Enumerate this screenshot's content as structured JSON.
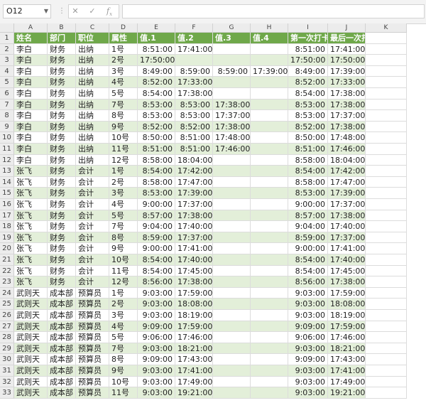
{
  "formula_bar": {
    "name_box": "O12",
    "cancel_icon": "✕",
    "confirm_icon": "✓",
    "fx_label": "f",
    "formula": ""
  },
  "columns": [
    "A",
    "B",
    "C",
    "D",
    "E",
    "F",
    "G",
    "H",
    "I",
    "J",
    "K"
  ],
  "header_row": [
    "姓名",
    "部门",
    "职位",
    "属性",
    "值.1",
    "值.2",
    "值.3",
    "值.4",
    "第一次打卡",
    "最后一次打卡",
    ""
  ],
  "rows": [
    [
      "李白",
      "财务",
      "出纳",
      "1号",
      "8:51:00",
      "17:41:00",
      "",
      "",
      "8:51:00",
      "17:41:00",
      ""
    ],
    [
      "李白",
      "财务",
      "出纳",
      "2号",
      "17:50:00",
      "",
      "",
      "",
      "17:50:00",
      "17:50:00",
      ""
    ],
    [
      "李白",
      "财务",
      "出纳",
      "3号",
      "8:49:00",
      "8:59:00",
      "8:59:00",
      "17:39:00",
      "8:49:00",
      "17:39:00",
      ""
    ],
    [
      "李白",
      "财务",
      "出纳",
      "4号",
      "8:52:00",
      "17:33:00",
      "",
      "",
      "8:52:00",
      "17:33:00",
      ""
    ],
    [
      "李白",
      "财务",
      "出纳",
      "5号",
      "8:54:00",
      "17:38:00",
      "",
      "",
      "8:54:00",
      "17:38:00",
      ""
    ],
    [
      "李白",
      "财务",
      "出纳",
      "7号",
      "8:53:00",
      "8:53:00",
      "17:38:00",
      "",
      "8:53:00",
      "17:38:00",
      ""
    ],
    [
      "李白",
      "财务",
      "出纳",
      "8号",
      "8:53:00",
      "8:53:00",
      "17:37:00",
      "",
      "8:53:00",
      "17:37:00",
      ""
    ],
    [
      "李白",
      "财务",
      "出纳",
      "9号",
      "8:52:00",
      "8:52:00",
      "17:38:00",
      "",
      "8:52:00",
      "17:38:00",
      ""
    ],
    [
      "李白",
      "财务",
      "出纳",
      "10号",
      "8:50:00",
      "8:51:00",
      "17:48:00",
      "",
      "8:50:00",
      "17:48:00",
      ""
    ],
    [
      "李白",
      "财务",
      "出纳",
      "11号",
      "8:51:00",
      "8:51:00",
      "17:46:00",
      "",
      "8:51:00",
      "17:46:00",
      ""
    ],
    [
      "李白",
      "财务",
      "出纳",
      "12号",
      "8:58:00",
      "18:04:00",
      "",
      "",
      "8:58:00",
      "18:04:00",
      ""
    ],
    [
      "张飞",
      "财务",
      "会计",
      "1号",
      "8:54:00",
      "17:42:00",
      "",
      "",
      "8:54:00",
      "17:42:00",
      ""
    ],
    [
      "张飞",
      "财务",
      "会计",
      "2号",
      "8:58:00",
      "17:47:00",
      "",
      "",
      "8:58:00",
      "17:47:00",
      ""
    ],
    [
      "张飞",
      "财务",
      "会计",
      "3号",
      "8:53:00",
      "17:39:00",
      "",
      "",
      "8:53:00",
      "17:39:00",
      ""
    ],
    [
      "张飞",
      "财务",
      "会计",
      "4号",
      "9:00:00",
      "17:37:00",
      "",
      "",
      "9:00:00",
      "17:37:00",
      ""
    ],
    [
      "张飞",
      "财务",
      "会计",
      "5号",
      "8:57:00",
      "17:38:00",
      "",
      "",
      "8:57:00",
      "17:38:00",
      ""
    ],
    [
      "张飞",
      "财务",
      "会计",
      "7号",
      "9:04:00",
      "17:40:00",
      "",
      "",
      "9:04:00",
      "17:40:00",
      ""
    ],
    [
      "张飞",
      "财务",
      "会计",
      "8号",
      "8:59:00",
      "17:37:00",
      "",
      "",
      "8:59:00",
      "17:37:00",
      ""
    ],
    [
      "张飞",
      "财务",
      "会计",
      "9号",
      "9:00:00",
      "17:41:00",
      "",
      "",
      "9:00:00",
      "17:41:00",
      ""
    ],
    [
      "张飞",
      "财务",
      "会计",
      "10号",
      "8:54:00",
      "17:40:00",
      "",
      "",
      "8:54:00",
      "17:40:00",
      ""
    ],
    [
      "张飞",
      "财务",
      "会计",
      "11号",
      "8:54:00",
      "17:45:00",
      "",
      "",
      "8:54:00",
      "17:45:00",
      ""
    ],
    [
      "张飞",
      "财务",
      "会计",
      "12号",
      "8:56:00",
      "17:38:00",
      "",
      "",
      "8:56:00",
      "17:38:00",
      ""
    ],
    [
      "武则天",
      "成本部",
      "预算员",
      "1号",
      "9:03:00",
      "17:59:00",
      "",
      "",
      "9:03:00",
      "17:59:00",
      ""
    ],
    [
      "武则天",
      "成本部",
      "预算员",
      "2号",
      "9:03:00",
      "18:08:00",
      "",
      "",
      "9:03:00",
      "18:08:00",
      ""
    ],
    [
      "武则天",
      "成本部",
      "预算员",
      "3号",
      "9:03:00",
      "18:19:00",
      "",
      "",
      "9:03:00",
      "18:19:00",
      ""
    ],
    [
      "武则天",
      "成本部",
      "预算员",
      "4号",
      "9:09:00",
      "17:59:00",
      "",
      "",
      "9:09:00",
      "17:59:00",
      ""
    ],
    [
      "武则天",
      "成本部",
      "预算员",
      "5号",
      "9:06:00",
      "17:46:00",
      "",
      "",
      "9:06:00",
      "17:46:00",
      ""
    ],
    [
      "武则天",
      "成本部",
      "预算员",
      "7号",
      "9:03:00",
      "18:21:00",
      "",
      "",
      "9:03:00",
      "18:21:00",
      ""
    ],
    [
      "武则天",
      "成本部",
      "预算员",
      "8号",
      "9:09:00",
      "17:43:00",
      "",
      "",
      "9:09:00",
      "17:43:00",
      ""
    ],
    [
      "武则天",
      "成本部",
      "预算员",
      "9号",
      "9:03:00",
      "17:41:00",
      "",
      "",
      "9:03:00",
      "17:41:00",
      ""
    ],
    [
      "武则天",
      "成本部",
      "预算员",
      "10号",
      "9:03:00",
      "17:49:00",
      "",
      "",
      "9:03:00",
      "17:49:00",
      ""
    ],
    [
      "武则天",
      "成本部",
      "预算员",
      "11号",
      "9:03:00",
      "19:21:00",
      "",
      "",
      "9:03:00",
      "19:21:00",
      ""
    ]
  ],
  "row_numbers": [
    "1",
    "2",
    "3",
    "4",
    "5",
    "6",
    "7",
    "8",
    "9",
    "10",
    "11",
    "12",
    "13",
    "14",
    "15",
    "16",
    "17",
    "18",
    "19",
    "20",
    "21",
    "22",
    "23",
    "24",
    "25",
    "26",
    "27",
    "28",
    "29",
    "30",
    "31",
    "32",
    "33"
  ],
  "colors": {
    "header_green": "#6fa84a",
    "band_green": "#e3efd9"
  }
}
